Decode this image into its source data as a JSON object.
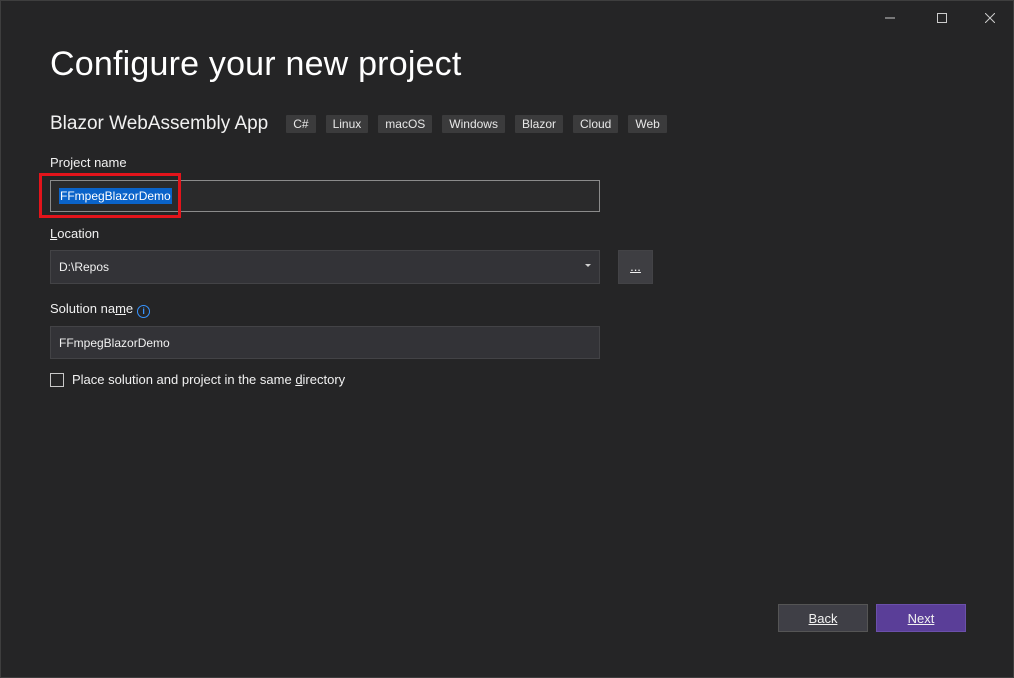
{
  "header": {
    "title": "Configure your new project",
    "template_name": "Blazor WebAssembly App",
    "tags": [
      "C#",
      "Linux",
      "macOS",
      "Windows",
      "Blazor",
      "Cloud",
      "Web"
    ]
  },
  "form": {
    "project_name_label": "Project name",
    "project_name_value": "FFmpegBlazorDemo",
    "location_label": "Location",
    "location_value": "D:\\Repos",
    "browse_label": "...",
    "solution_name_label": "Solution name",
    "solution_name_value": "FFmpegBlazorDemo",
    "same_directory_label": "Place solution and project in the same directory",
    "same_directory_checked": false
  },
  "footer": {
    "back_label": "Back",
    "next_label": "Next"
  },
  "colors": {
    "accent": "#5a3e98",
    "highlight": "#e3141b",
    "selection": "#0a63c9"
  }
}
